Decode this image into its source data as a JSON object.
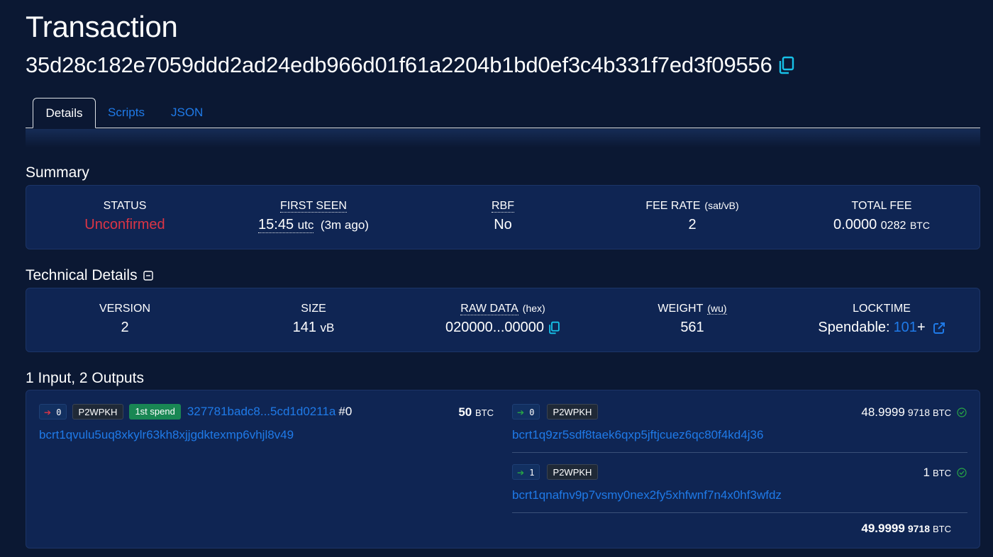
{
  "page": {
    "title": "Transaction",
    "txid": "35d28c182e7059ddd2ad24edb966d01f61a2204b1bd0ef3c4b331f7ed3f09556"
  },
  "tabs": [
    "Details",
    "Scripts",
    "JSON"
  ],
  "summary": {
    "title": "Summary",
    "status_label": "STATUS",
    "status_value": "Unconfirmed",
    "first_seen_label": "FIRST SEEN",
    "first_seen_time": "15:45",
    "first_seen_tz": "utc",
    "first_seen_ago": "(3m ago)",
    "rbf_label": "RBF",
    "rbf_value": "No",
    "fee_rate_label": "FEE RATE",
    "fee_rate_unit": "(sat/vB)",
    "fee_rate_value": "2",
    "total_fee_label": "TOTAL FEE",
    "total_fee_main": "0.0000",
    "total_fee_rest": "0282",
    "total_fee_unit": "BTC"
  },
  "technical": {
    "title": "Technical Details",
    "version_label": "VERSION",
    "version_value": "2",
    "size_label": "SIZE",
    "size_value": "141",
    "size_unit": "vB",
    "raw_label": "RAW DATA",
    "raw_unit": "(hex)",
    "raw_value": "020000...00000",
    "weight_label": "WEIGHT",
    "weight_unit": "(wu)",
    "weight_value": "561",
    "locktime_label": "LOCKTIME",
    "locktime_prefix": "Spendable:",
    "locktime_link": "101",
    "locktime_suffix": "+"
  },
  "io": {
    "title": "1 Input, 2 Outputs",
    "input": {
      "index": "0",
      "type": "P2WPKH",
      "spend_badge": "1st spend",
      "prevout": "327781badc8...5cd1d0211a",
      "prevout_index": "#0",
      "amount_main": "50",
      "amount_unit": "BTC",
      "address": "bcrt1qvulu5uq8xkylr63kh8xjjgdktexmp6vhjl8v49"
    },
    "outputs": [
      {
        "index": "0",
        "type": "P2WPKH",
        "amount_main": "48.9999",
        "amount_rest": "9718",
        "amount_unit": "BTC",
        "address": "bcrt1q9zr5sdf8taek6qxp5jftjcuez6qc80f4kd4j36"
      },
      {
        "index": "1",
        "type": "P2WPKH",
        "amount_main": "1",
        "amount_rest": "",
        "amount_unit": "BTC",
        "address": "bcrt1qnafnv9p7vsmy0nex2fy5xhfwnf7n4x0hf3wfdz"
      }
    ],
    "total_main": "49.9999",
    "total_rest": "9718",
    "total_unit": "BTC"
  },
  "colors": {
    "background": "#0b1833",
    "card": "#0f2553",
    "link": "#1f7ae8",
    "unconfirmed": "#dc3545",
    "success": "#28a745",
    "copy": "#17c1e8"
  }
}
